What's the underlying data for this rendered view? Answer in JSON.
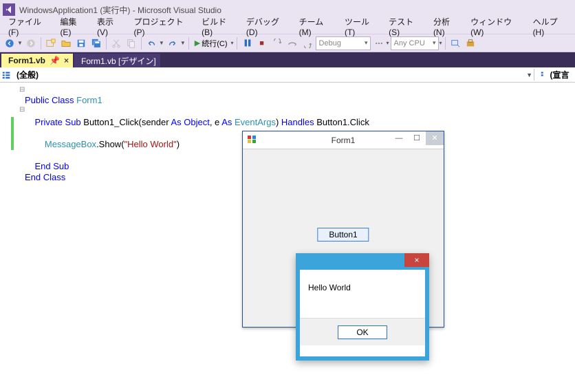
{
  "titlebar": {
    "text": "WindowsApplication1 (実行中) - Microsoft Visual Studio"
  },
  "menu": {
    "file": "ファイル(F)",
    "edit": "編集(E)",
    "view": "表示(V)",
    "project": "プロジェクト(P)",
    "build": "ビルド(B)",
    "debug": "デバッグ(D)",
    "team": "チーム(M)",
    "tools": "ツール(T)",
    "test": "テスト(S)",
    "analyze": "分析(N)",
    "window": "ウィンドウ(W)",
    "help": "ヘルプ(H)"
  },
  "toolbar": {
    "continue_label": "続行(C)",
    "config": "Debug",
    "platform": "Any CPU"
  },
  "tabs": {
    "active": "Form1.vb",
    "inactive": "Form1.vb [デザイン]"
  },
  "codeNav": {
    "left": "(全般)",
    "right": "(宣言"
  },
  "code": {
    "l1a": "Public Class ",
    "l1b": "Form1",
    "l2a": "Private Sub ",
    "l2b": "Button1_Click(sender ",
    "l2c": "As Object",
    "l2d": ", e ",
    "l2e": "As ",
    "l2f": "EventArgs",
    "l2g": ") ",
    "l2h": "Handles ",
    "l2i": "Button1.Click",
    "l3a": "MessageBox",
    "l3b": ".Show(",
    "l3c": "\"Hello World\"",
    "l3d": ")",
    "l4": "End Sub",
    "l5": "End Class"
  },
  "form": {
    "title": "Form1",
    "button": "Button1"
  },
  "msgbox": {
    "text": "Hello World",
    "ok": "OK",
    "close": "×"
  },
  "icons": {
    "min": "—",
    "max": "☐",
    "close": "✕",
    "play": "▶",
    "pause": "❚❚",
    "stop": "■"
  }
}
